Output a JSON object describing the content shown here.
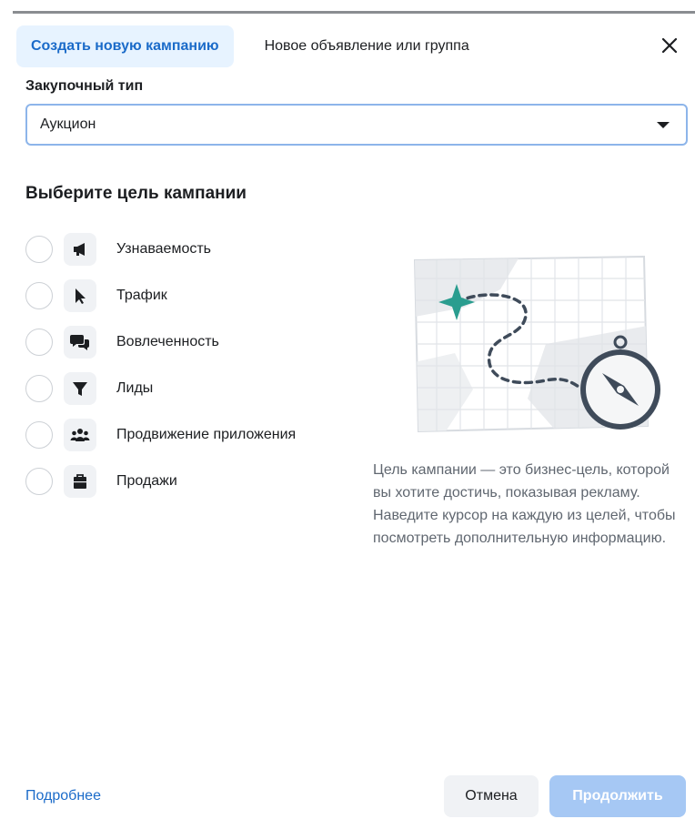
{
  "dialog": {
    "tabs": [
      {
        "label": "Создать новую кампанию",
        "active": true
      },
      {
        "label": "Новое объявление или группа",
        "active": false
      }
    ],
    "close_icon": "close-icon"
  },
  "buying_type": {
    "label": "Закупочный тип",
    "selected": "Аукцион"
  },
  "objective_section": {
    "title": "Выберите цель кампании",
    "items": [
      {
        "label": "Узнаваемость",
        "icon": "megaphone-icon",
        "selected": false
      },
      {
        "label": "Трафик",
        "icon": "cursor-icon",
        "selected": false
      },
      {
        "label": "Вовлеченность",
        "icon": "chat-bubbles-icon",
        "selected": false
      },
      {
        "label": "Лиды",
        "icon": "funnel-icon",
        "selected": false
      },
      {
        "label": "Продвижение приложения",
        "icon": "people-icon",
        "selected": false
      },
      {
        "label": "Продажи",
        "icon": "shopping-bag-icon",
        "selected": false
      }
    ],
    "description": "Цель кампании — это бизнес-цель, которой вы хотите достичь, показывая рекламу. Наведите курсор на каждую из целей, чтобы посмотреть дополнительную информацию."
  },
  "footer": {
    "learn_more": "Подробнее",
    "cancel": "Отмена",
    "continue": "Продолжить"
  },
  "colors": {
    "accent": "#1b6bc9",
    "active_tab_bg": "#e7f3ff",
    "continue_disabled": "#a6c8f4"
  }
}
